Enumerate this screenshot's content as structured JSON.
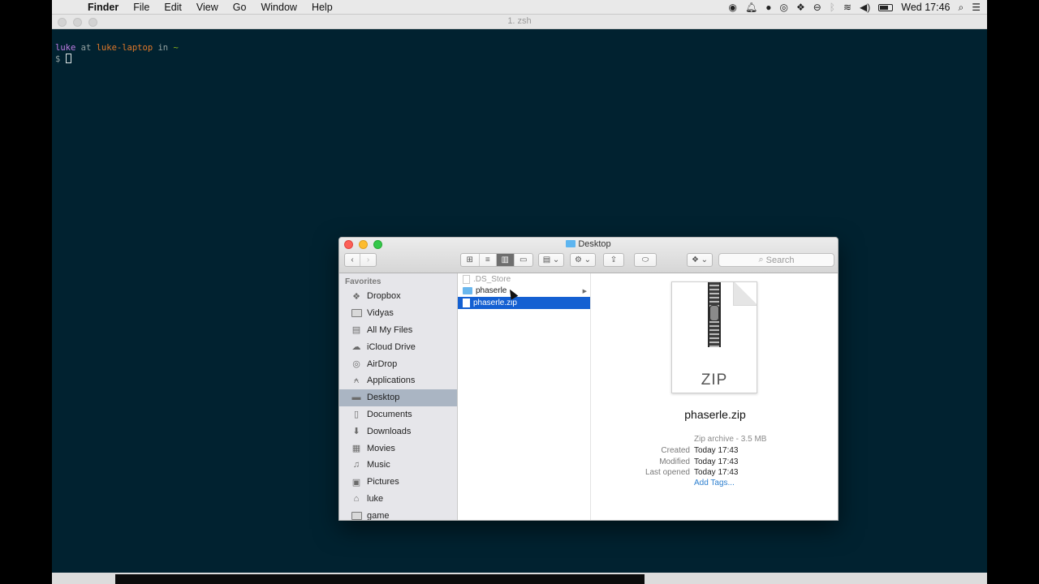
{
  "menubar": {
    "app_name": "Finder",
    "menus": [
      "File",
      "Edit",
      "View",
      "Go",
      "Window",
      "Help"
    ],
    "clock": "Wed 17:46"
  },
  "terminal": {
    "title": "1. zsh",
    "user": "luke",
    "at": "at",
    "host": "luke-laptop",
    "in": "in",
    "dir": "~",
    "prompt": "$"
  },
  "finder": {
    "title": "Desktop",
    "search_placeholder": "Search",
    "sidebar": {
      "section": "Favorites",
      "items": [
        {
          "label": "Dropbox",
          "icon": "dropbox-icon"
        },
        {
          "label": "Vidyas",
          "icon": "folder-icon"
        },
        {
          "label": "All My Files",
          "icon": "all-files-icon"
        },
        {
          "label": "iCloud Drive",
          "icon": "cloud-icon"
        },
        {
          "label": "AirDrop",
          "icon": "airdrop-icon"
        },
        {
          "label": "Applications",
          "icon": "applications-icon"
        },
        {
          "label": "Desktop",
          "icon": "desktop-icon",
          "selected": true
        },
        {
          "label": "Documents",
          "icon": "documents-icon"
        },
        {
          "label": "Downloads",
          "icon": "downloads-icon"
        },
        {
          "label": "Movies",
          "icon": "movies-icon"
        },
        {
          "label": "Music",
          "icon": "music-icon"
        },
        {
          "label": "Pictures",
          "icon": "pictures-icon"
        },
        {
          "label": "luke",
          "icon": "home-icon"
        },
        {
          "label": "game",
          "icon": "folder-icon"
        }
      ]
    },
    "column": [
      {
        "label": ".DS_Store",
        "kind": "file",
        "faded": true
      },
      {
        "label": "phaserle",
        "kind": "folder"
      },
      {
        "label": "phaserle.zip",
        "kind": "file",
        "selected": true
      }
    ],
    "preview": {
      "icon_label": "ZIP",
      "name": "phaserle.zip",
      "kind": "Zip archive - 3.5 MB",
      "created_label": "Created",
      "created": "Today 17:43",
      "modified_label": "Modified",
      "modified": "Today 17:43",
      "opened_label": "Last opened",
      "opened": "Today 17:43",
      "add_tags": "Add Tags..."
    }
  }
}
